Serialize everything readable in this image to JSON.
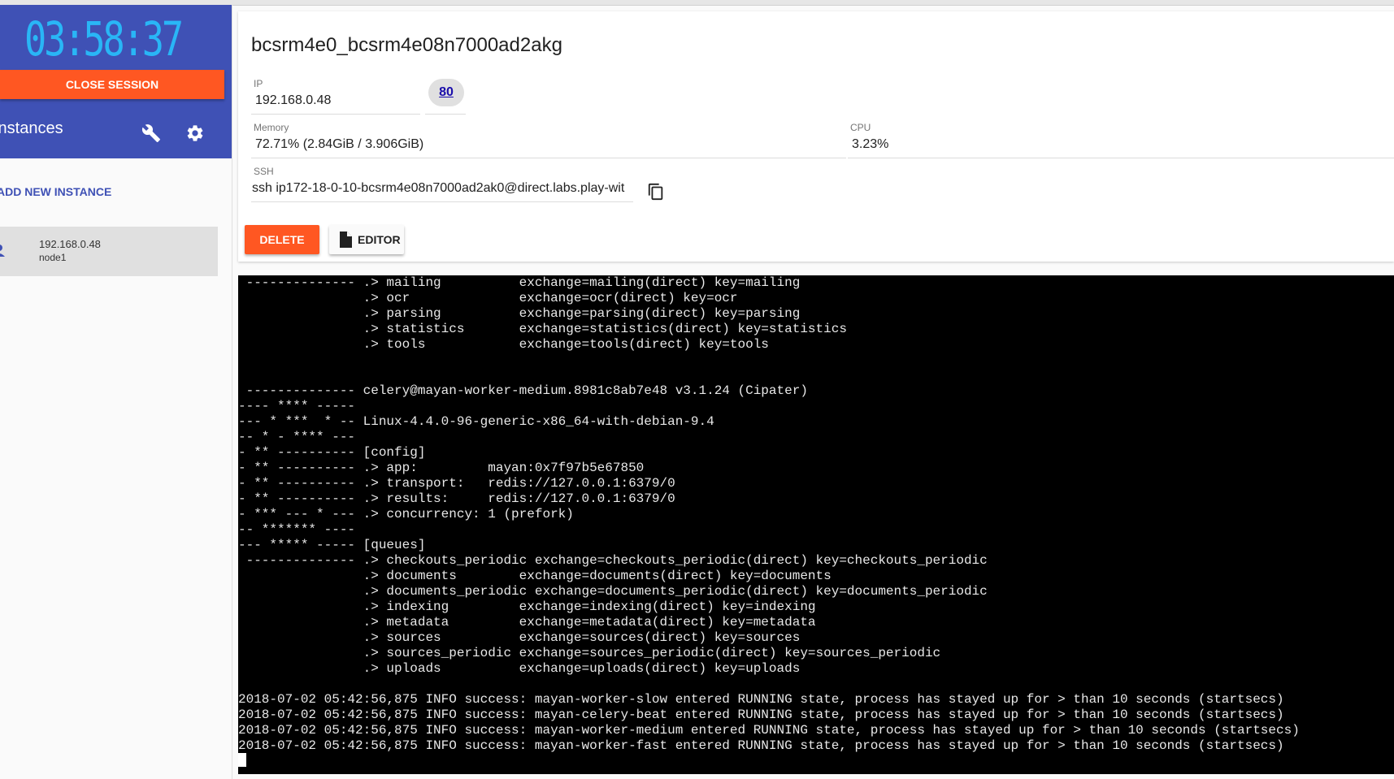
{
  "sidebar": {
    "timer": "03:58:37",
    "close_session_label": "CLOSE SESSION",
    "instances_title": "Instances",
    "add_instance_label": "ADD NEW INSTANCE",
    "instances": [
      {
        "ip": "192.168.0.48",
        "hostname": "node1"
      }
    ],
    "icons": {
      "settings_tool": "wrench-icon",
      "settings": "gear-icon",
      "instance": "person-icon"
    }
  },
  "instance": {
    "name": "bcsrm4e0_bcsrm4e08n7000ad2akg",
    "ip_label": "IP",
    "ip": "192.168.0.48",
    "port": "80",
    "memory_label": "Memory",
    "memory": "72.71% (2.84GiB / 3.906GiB)",
    "cpu_label": "CPU",
    "cpu": "3.23%",
    "ssh_label": "SSH",
    "ssh": "ssh ip172-18-0-10-bcsrm4e08n7000ad2ak0@direct.labs.play-wit",
    "delete_label": "DELETE",
    "editor_label": "EDITOR"
  },
  "colors": {
    "primary": "#3f51b5",
    "accent": "#ff5722",
    "timer": "#29b6f6"
  },
  "terminal": {
    "lines": [
      " -------------- .> mailing          exchange=mailing(direct) key=mailing",
      "                .> ocr              exchange=ocr(direct) key=ocr",
      "                .> parsing          exchange=parsing(direct) key=parsing",
      "                .> statistics       exchange=statistics(direct) key=statistics",
      "                .> tools            exchange=tools(direct) key=tools",
      "",
      "",
      " -------------- celery@mayan-worker-medium.8981c8ab7e48 v3.1.24 (Cipater)",
      "---- **** -----",
      "--- * ***  * -- Linux-4.4.0-96-generic-x86_64-with-debian-9.4",
      "-- * - **** ---",
      "- ** ---------- [config]",
      "- ** ---------- .> app:         mayan:0x7f97b5e67850",
      "- ** ---------- .> transport:   redis://127.0.0.1:6379/0",
      "- ** ---------- .> results:     redis://127.0.0.1:6379/0",
      "- *** --- * --- .> concurrency: 1 (prefork)",
      "-- ******* ----",
      "--- ***** ----- [queues]",
      " -------------- .> checkouts_periodic exchange=checkouts_periodic(direct) key=checkouts_periodic",
      "                .> documents        exchange=documents(direct) key=documents",
      "                .> documents_periodic exchange=documents_periodic(direct) key=documents_periodic",
      "                .> indexing         exchange=indexing(direct) key=indexing",
      "                .> metadata         exchange=metadata(direct) key=metadata",
      "                .> sources          exchange=sources(direct) key=sources",
      "                .> sources_periodic exchange=sources_periodic(direct) key=sources_periodic",
      "                .> uploads          exchange=uploads(direct) key=uploads",
      "",
      "2018-07-02 05:42:56,875 INFO success: mayan-worker-slow entered RUNNING state, process has stayed up for > than 10 seconds (startsecs)",
      "2018-07-02 05:42:56,875 INFO success: mayan-celery-beat entered RUNNING state, process has stayed up for > than 10 seconds (startsecs)",
      "2018-07-02 05:42:56,875 INFO success: mayan-worker-medium entered RUNNING state, process has stayed up for > than 10 seconds (startsecs)",
      "2018-07-02 05:42:56,875 INFO success: mayan-worker-fast entered RUNNING state, process has stayed up for > than 10 seconds (startsecs)"
    ]
  }
}
